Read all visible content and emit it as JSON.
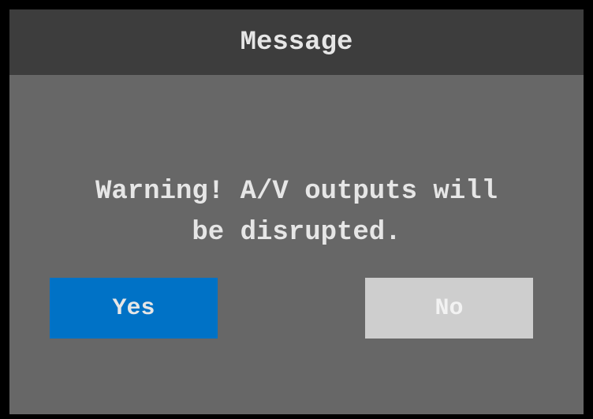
{
  "dialog": {
    "title": "Message",
    "message_line1": "Warning! A/V outputs will",
    "message_line2": "be disrupted.",
    "yes_label": "Yes",
    "no_label": "No"
  },
  "colors": {
    "background": "#000000",
    "dialog_body": "#676767",
    "title_bar": "#3d3d3d",
    "text": "#e6e6e6",
    "yes_button": "#0072c6",
    "no_button": "#cecece"
  }
}
